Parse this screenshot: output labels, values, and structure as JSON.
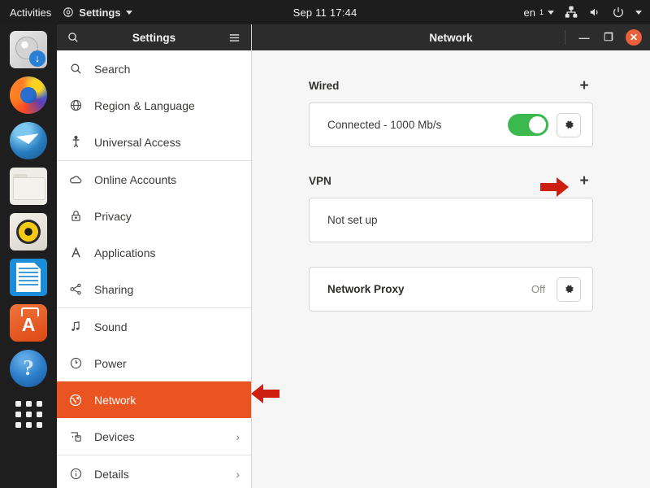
{
  "topbar": {
    "activities": "Activities",
    "app_menu": "Settings",
    "app_icon": "settings-gear-icon",
    "clock": "Sep 11  17:44",
    "language": "en",
    "language_sub": "1",
    "icons": [
      "network-wired-icon",
      "volume-icon",
      "power-icon",
      "dropdown-caret-icon"
    ]
  },
  "dock": {
    "items": [
      {
        "name": "install-ubuntu",
        "icon": "disk-install-icon"
      },
      {
        "name": "firefox",
        "icon": "firefox-icon"
      },
      {
        "name": "thunderbird",
        "icon": "thunderbird-icon"
      },
      {
        "name": "files",
        "icon": "files-folder-icon"
      },
      {
        "name": "rhythmbox",
        "icon": "rhythmbox-icon"
      },
      {
        "name": "libreoffice-writer",
        "icon": "libreoffice-writer-icon"
      },
      {
        "name": "ubuntu-software",
        "icon": "ubuntu-software-icon"
      },
      {
        "name": "help",
        "icon": "help-icon"
      },
      {
        "name": "show-applications",
        "icon": "apps-grid-icon"
      }
    ]
  },
  "sidebar": {
    "title": "Settings",
    "search_icon": "search-icon",
    "menu_icon": "hamburger-menu-icon",
    "items": [
      {
        "label": "Search",
        "icon": "search-icon",
        "selected": false,
        "chevron": false,
        "separator_after": false
      },
      {
        "label": "Region & Language",
        "icon": "globe-icon",
        "selected": false,
        "chevron": false,
        "separator_after": false
      },
      {
        "label": "Universal Access",
        "icon": "accessibility-icon",
        "selected": false,
        "chevron": false,
        "separator_after": true
      },
      {
        "label": "Online Accounts",
        "icon": "cloud-icon",
        "selected": false,
        "chevron": false,
        "separator_after": false
      },
      {
        "label": "Privacy",
        "icon": "lock-icon",
        "selected": false,
        "chevron": false,
        "separator_after": false
      },
      {
        "label": "Applications",
        "icon": "applications-a-icon",
        "selected": false,
        "chevron": false,
        "separator_after": false
      },
      {
        "label": "Sharing",
        "icon": "share-nodes-icon",
        "selected": false,
        "chevron": false,
        "separator_after": true
      },
      {
        "label": "Sound",
        "icon": "music-note-icon",
        "selected": false,
        "chevron": false,
        "separator_after": false
      },
      {
        "label": "Power",
        "icon": "power-circle-icon",
        "selected": false,
        "chevron": false,
        "separator_after": false
      },
      {
        "label": "Network",
        "icon": "globe-network-icon",
        "selected": true,
        "chevron": false,
        "separator_after": false
      },
      {
        "label": "Devices",
        "icon": "devices-icon",
        "selected": false,
        "chevron": true,
        "separator_after": true
      },
      {
        "label": "Details",
        "icon": "info-circle-icon",
        "selected": false,
        "chevron": true,
        "separator_after": false
      }
    ],
    "chevron_glyph": "›",
    "selected_color": "#e95420"
  },
  "window": {
    "title": "Network",
    "minimize_glyph": "—",
    "maximize_glyph": "❐",
    "close_glyph": "✕"
  },
  "main": {
    "wired": {
      "heading": "Wired",
      "add_glyph": "+",
      "connection_label": "Connected - 1000 Mb/s",
      "toggle_on": true,
      "toggle_color": "#3bb94f",
      "settings_icon": "gear-icon"
    },
    "vpn": {
      "heading": "VPN",
      "add_glyph": "+",
      "status_label": "Not set up"
    },
    "proxy": {
      "label": "Network Proxy",
      "status": "Off",
      "settings_icon": "gear-icon"
    }
  },
  "annotations": {
    "color": "#cc1f10",
    "arrow_vpn_add": "arrow-right-to-vpn-add",
    "arrow_network_item": "arrow-left-to-network-sidebar-item"
  }
}
